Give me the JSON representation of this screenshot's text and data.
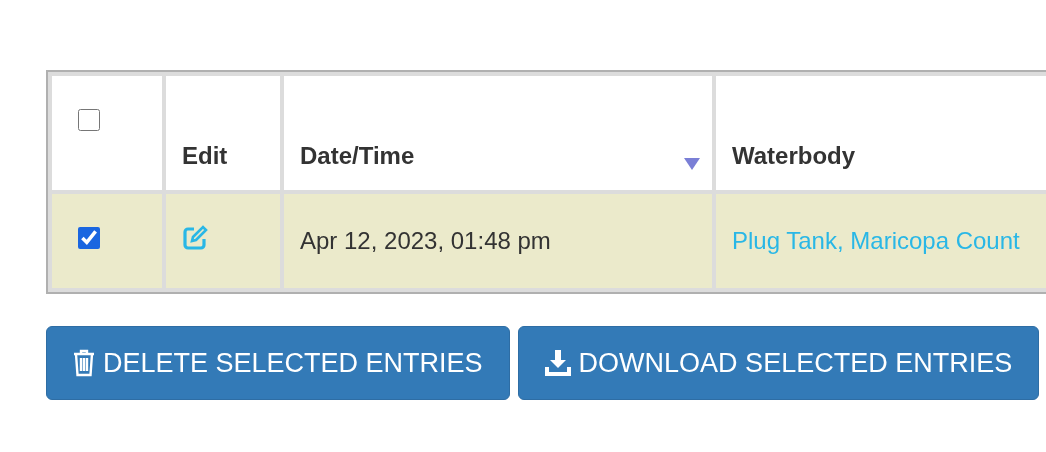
{
  "table": {
    "select_all": {
      "checked": false
    },
    "columns": [
      {
        "label": "Edit",
        "sorted": false
      },
      {
        "label": "Date/Time",
        "sorted": true
      },
      {
        "label": "Waterbody",
        "sorted": false
      }
    ],
    "rows": [
      {
        "checked": true,
        "selected": true,
        "date_time": "Apr 12, 2023, 01:48 pm",
        "waterbody": "Plug Tank, Maricopa Count"
      }
    ]
  },
  "buttons": [
    {
      "kind": "delete",
      "label": "DELETE SELECTED ENTRIES"
    },
    {
      "kind": "download",
      "label": "DOWNLOAD SELECTED ENTRIES"
    }
  ]
}
